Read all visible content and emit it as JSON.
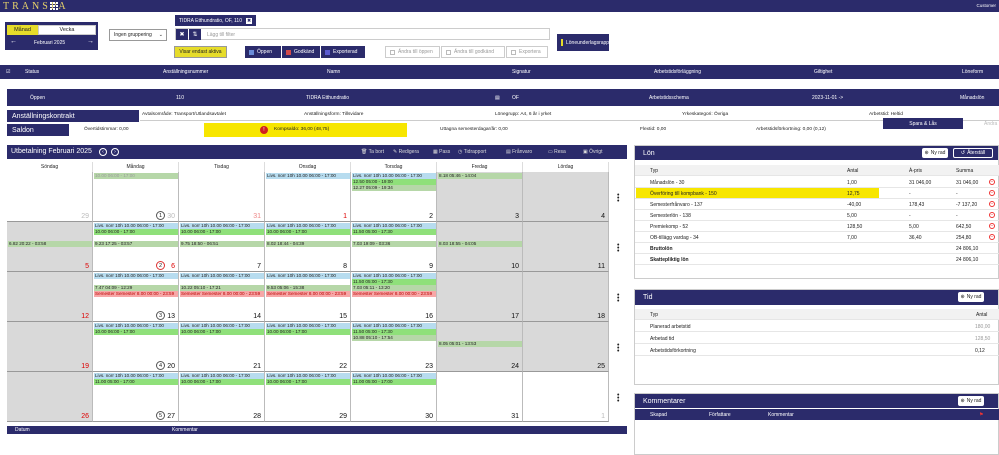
{
  "app": {
    "logo": "TRANSPA",
    "customer": "Customer"
  },
  "period": {
    "tab_month": "Månad",
    "tab_week": "Vecka",
    "month": "Februari 2025",
    "prev": "←",
    "next": "→"
  },
  "grouping": {
    "value": "Ingen gruppering"
  },
  "filter": {
    "chip": "TIDRA Etthundratio, OF, 110",
    "placeholder": "Lägg till filter"
  },
  "actions": {
    "show_active": "Visar endast aktiva",
    "open": "Öppen",
    "approved": "Godkänd",
    "exported": "Exporterad",
    "change_open": "Ändra till öppen",
    "change_approved": "Ändra till godkänd",
    "export": "Exportera",
    "salary_report": "Löneunderlagsrapport"
  },
  "columns": {
    "status": "Status",
    "employee_no": "Anställningsnummer",
    "name": "Namn",
    "signature": "Signatur",
    "schedule": "Arbetstidsförläggning",
    "validity": "Giltighet",
    "wage_form": "Löneform"
  },
  "employee": {
    "status": "Öppen",
    "number": "110",
    "name": "TIDRA Etthundratio",
    "signature": "OF",
    "schedule": "Arbetstidsschema",
    "validity": "2023-11-01 ->",
    "wage_form": "Månadslön"
  },
  "contract": {
    "title": "Anställningskontrakt",
    "area": "Avtalsområde: Transport/Utlandsavtalet",
    "form": "Anställningsform: Tillsvidare",
    "salary_group": "Lönegrupp: A4, 6 år i yrket",
    "category": "Yrkeskategori: Övriga",
    "hours": "Arbetstid: Heltid"
  },
  "saldon": {
    "title": "Saldon",
    "overtime": "Övertidstimmar: 0,00",
    "comp": "Kompsaldo: 36,00 (48,75)",
    "vacation": "Uttagna semesterdagar/år: 0,00",
    "flex": "Flextid: 0,00",
    "reduction": "Arbetstidsförkortning: 0,00 (0,12)",
    "save": "Spara & Lås",
    "change": "Ändra"
  },
  "calendar": {
    "title": "Utbetalning Februari 2025",
    "toolbar": [
      "Ta bort",
      "Redigera",
      "Pass",
      "Tidrapport",
      "Frånvaro",
      "Resa",
      "Övrigt"
    ],
    "days": [
      "Söndag",
      "Måndag",
      "Tisdag",
      "Onsdag",
      "Torsdag",
      "Fredag",
      "Lördag"
    ],
    "weeks": [
      {
        "week": "1",
        "cells": [
          {
            "day": "29",
            "gray": false,
            "other": true,
            "events": []
          },
          {
            "day": "30",
            "gray": false,
            "other": true,
            "events": [
              {
                "c": "lgreen",
                "t": "10.00 06:00 - 17:00",
                "faded": true
              }
            ]
          },
          {
            "day": "31",
            "red": true,
            "gray": false,
            "other": true,
            "events": []
          },
          {
            "day": "1",
            "red": true,
            "gray": false,
            "events": [
              {
                "c": "blue",
                "t": "Livs. norr 10h 10.00 06:00 - 17:00"
              }
            ]
          },
          {
            "day": "2",
            "gray": false,
            "events": [
              {
                "c": "blue",
                "t": "Livs. norr 10h 10.00 06:00 - 17:00"
              },
              {
                "c": "green",
                "t": "12.50 05:00 - 19:00"
              },
              {
                "c": "lgreen",
                "t": "12.27 05:09 - 19:34"
              }
            ]
          },
          {
            "day": "3",
            "gray": true,
            "events": [
              {
                "c": "lgreen",
                "t": "8.18 05:46 - 14:04",
                "indent": -85
              }
            ]
          },
          {
            "day": "4",
            "gray": true,
            "events": []
          }
        ]
      },
      {
        "week": "2",
        "cells": [
          {
            "day": "5",
            "red": true,
            "gray": true,
            "events": [
              {
                "c": "lgreen",
                "t": "6.82 20:22 - 03:58",
                "row": 3
              }
            ]
          },
          {
            "day": "6",
            "red": true,
            "gray": false,
            "events": [
              {
                "c": "blue",
                "t": "Livs. norr 10h 10.00 06:00 - 17:00"
              },
              {
                "c": "green",
                "t": "10.00 06:00 - 17:00"
              },
              {
                "c": "lgreen",
                "t": "9.23 17:25 - 03:57",
                "row": 3
              }
            ]
          },
          {
            "day": "7",
            "gray": false,
            "events": [
              {
                "c": "blue",
                "t": "Livs. norr 10h 10.00 06:00 - 17:00"
              },
              {
                "c": "green",
                "t": "10.00 06:00 - 17:00"
              },
              {
                "c": "lgreen",
                "t": "9.75 18:50 - 06:51",
                "row": 3
              }
            ]
          },
          {
            "day": "8",
            "gray": false,
            "events": [
              {
                "c": "blue",
                "t": "Livs. norr 10h 10.00 06:00 - 17:00"
              },
              {
                "c": "green",
                "t": "10.00 06:00 - 17:00"
              },
              {
                "c": "lgreen",
                "t": "8.02 18:44 - 04:39",
                "row": 3
              }
            ]
          },
          {
            "day": "9",
            "gray": false,
            "events": [
              {
                "c": "blue",
                "t": "Livs. norr 10h 10.00 06:00 - 17:00"
              },
              {
                "c": "green",
                "t": "11.50 05:00 - 17:30"
              },
              {
                "c": "lgreen",
                "t": "7.03 19:09 - 03:36",
                "row": 3
              }
            ]
          },
          {
            "day": "10",
            "gray": true,
            "events": [
              {
                "c": "lgreen",
                "t": "8.03 18:55 - 04:05",
                "row": 3
              }
            ]
          },
          {
            "day": "11",
            "gray": true,
            "events": []
          }
        ]
      },
      {
        "week": "3",
        "cells": [
          {
            "day": "12",
            "red": true,
            "gray": true,
            "events": []
          },
          {
            "day": "13",
            "gray": false,
            "events": [
              {
                "c": "blue",
                "t": "Livs. norr 10h 10.00 06:00 - 17:00"
              },
              {
                "c": "lgreen",
                "t": "7.47 04:09 - 12:29",
                "row": 2
              },
              {
                "c": "red",
                "t": "Semester Semester 8.00 00:00 - 23:59",
                "row": 3
              }
            ]
          },
          {
            "day": "14",
            "gray": false,
            "events": [
              {
                "c": "blue",
                "t": "Livs. norr 10h 10.00 06:00 - 17:00"
              },
              {
                "c": "lgreen",
                "t": "10.22 05:10 - 17:21",
                "row": 2
              },
              {
                "c": "red",
                "t": "Semester Semester 8.00 00:00 - 23:59",
                "row": 3
              }
            ]
          },
          {
            "day": "15",
            "gray": false,
            "events": [
              {
                "c": "blue",
                "t": "Livs. norr 10h 10.00 06:00 - 17:00"
              },
              {
                "c": "lgreen",
                "t": "9.53 05:06 - 15:38",
                "row": 2
              },
              {
                "c": "red",
                "t": "Semester Semester 8.00 00:00 - 23:59",
                "row": 3
              }
            ]
          },
          {
            "day": "16",
            "gray": false,
            "events": [
              {
                "c": "blue",
                "t": "Livs. norr 10h 10.00 06:00 - 17:00"
              },
              {
                "c": "green",
                "t": "11.50 05:00 - 17:30"
              },
              {
                "c": "lgreen",
                "t": "7.03 05:11 - 13:20"
              },
              {
                "c": "red",
                "t": "Semester Semester 8.00 00:00 - 23:59"
              }
            ]
          },
          {
            "day": "17",
            "gray": true,
            "events": []
          },
          {
            "day": "18",
            "gray": true,
            "events": []
          }
        ]
      },
      {
        "week": "4",
        "cells": [
          {
            "day": "19",
            "red": true,
            "gray": true,
            "events": []
          },
          {
            "day": "20",
            "gray": false,
            "events": [
              {
                "c": "blue",
                "t": "Livs. norr 10h 10.00 06:00 - 17:00"
              },
              {
                "c": "green",
                "t": "10.00 06:00 - 17:00"
              }
            ]
          },
          {
            "day": "21",
            "gray": false,
            "events": [
              {
                "c": "blue",
                "t": "Livs. norr 10h 10.00 06:00 - 17:00"
              },
              {
                "c": "green",
                "t": "10.00 06:00 - 17:00"
              }
            ]
          },
          {
            "day": "22",
            "gray": false,
            "events": [
              {
                "c": "blue",
                "t": "Livs. norr 10h 10.00 06:00 - 17:00"
              },
              {
                "c": "green",
                "t": "10.00 06:00 - 17:00"
              }
            ]
          },
          {
            "day": "23",
            "gray": false,
            "events": [
              {
                "c": "blue",
                "t": "Livs. norr 10h 10.00 06:00 - 17:00"
              },
              {
                "c": "green",
                "t": "11.50 05:00 - 17:30"
              },
              {
                "c": "lgreen",
                "t": "10.88 05:10 - 17:54"
              }
            ]
          },
          {
            "day": "24",
            "gray": true,
            "events": [
              {
                "c": "lgreen",
                "t": "8.05 05:01 - 13:53",
                "row": 3,
                "indent": -85
              }
            ]
          },
          {
            "day": "25",
            "gray": true,
            "events": []
          }
        ]
      },
      {
        "week": "5",
        "cells": [
          {
            "day": "26",
            "red": true,
            "gray": true,
            "events": []
          },
          {
            "day": "27",
            "gray": false,
            "events": [
              {
                "c": "blue",
                "t": "Livs. norr 10h 10.00 06:00 - 17:00"
              },
              {
                "c": "green",
                "t": "11.00 05:00 - 17:00"
              }
            ]
          },
          {
            "day": "28",
            "gray": false,
            "events": [
              {
                "c": "blue",
                "t": "Livs. norr 10h 10.00 06:00 - 17:00"
              },
              {
                "c": "green",
                "t": "10.00 06:00 - 17:00"
              }
            ]
          },
          {
            "day": "29",
            "gray": false,
            "events": [
              {
                "c": "blue",
                "t": "Livs. norr 10h 10.00 06:00 - 17:00"
              },
              {
                "c": "green",
                "t": "10.00 06:00 - 17:00"
              }
            ]
          },
          {
            "day": "30",
            "gray": false,
            "events": [
              {
                "c": "blue",
                "t": "Livs. norr 10h 10.00 06:00 - 17:00"
              },
              {
                "c": "green",
                "t": "11.00 05:00 - 17:00"
              }
            ]
          },
          {
            "day": "31",
            "gray": false,
            "events": []
          },
          {
            "day": "1",
            "gray": false,
            "other": true,
            "events": []
          }
        ]
      }
    ]
  },
  "bottom": {
    "datum": "Datum",
    "kommentar": "Kommentar"
  },
  "lon": {
    "title": "Lön",
    "add": "Ny rad",
    "reset": "Återställ",
    "headers": [
      "Typ",
      "Antal",
      "À-pris",
      "Summa"
    ],
    "rows": [
      {
        "typ": "Månadslön - 30",
        "antal": "1,00",
        "apris": "31 046,00",
        "summa": "31 046,00",
        "del": true
      },
      {
        "typ": "Överföring till kompbank - 150",
        "antal": "12,75",
        "apris": "-",
        "summa": "-",
        "del": true,
        "hl": true
      },
      {
        "typ": "Semesterfrånvaro - 137",
        "antal": "-40,00",
        "apris": "178,43",
        "summa": "-7 137,20",
        "del": true
      },
      {
        "typ": "Semesterlön - 138",
        "antal": "5,00",
        "apris": "-",
        "summa": "-",
        "del": true
      },
      {
        "typ": "Premiekomp - 52",
        "antal": "128,50",
        "apris": "5,00",
        "summa": "642,50",
        "del": true
      },
      {
        "typ": "OB-tillägg vardag - 34",
        "antal": "7,00",
        "apris": "36,40",
        "summa": "254,80",
        "del": true
      },
      {
        "typ": "Bruttolön",
        "antal": "",
        "apris": "",
        "summa": "24 806,10",
        "bold": true
      },
      {
        "typ": "Skattepliktig lön",
        "antal": "",
        "apris": "",
        "summa": "24 806,10",
        "bold": true
      }
    ]
  },
  "tid": {
    "title": "Tid",
    "add": "Ny rad",
    "headers": [
      "Typ",
      "Antal"
    ],
    "rows": [
      {
        "typ": "Planerad arbetstid",
        "antal": "180,00"
      },
      {
        "typ": "Arbetad tid",
        "antal": "128,50"
      },
      {
        "typ": "Arbetstidsförkortning",
        "antal": "0,12"
      }
    ]
  },
  "kommentarer": {
    "title": "Kommentarer",
    "add": "Ny rad",
    "headers": [
      "Skapad",
      "Författare",
      "Kommentar"
    ]
  }
}
